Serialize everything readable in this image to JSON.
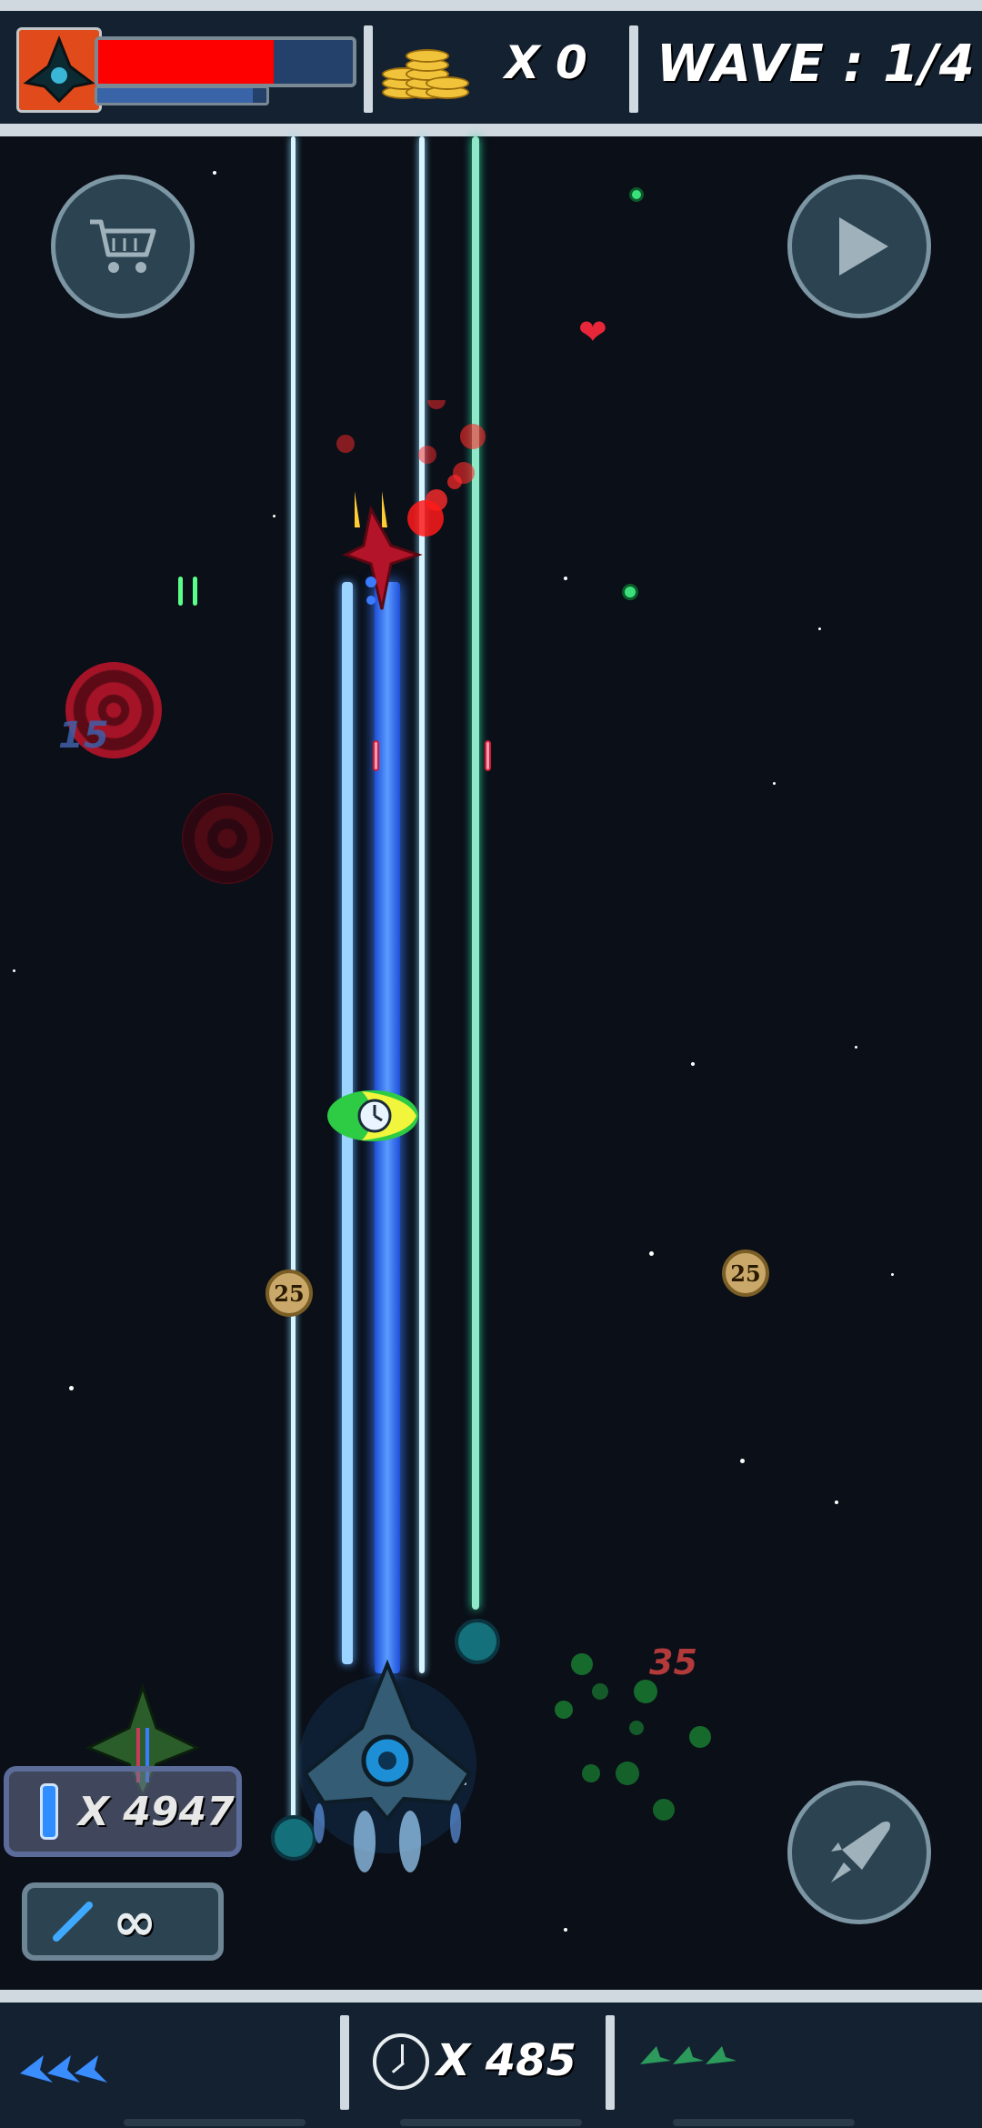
{
  "hud": {
    "player_health_pct": 0.69,
    "player_shield_pct": 0.92,
    "coins_label": "X 0",
    "wave_label": "WAVE : 1/4"
  },
  "powerup": {
    "label": "X 4947"
  },
  "weapon": {
    "label": "∞"
  },
  "bottom": {
    "timer_label": "X 485"
  },
  "drops": {
    "coin_left": "25",
    "coin_right": "25"
  },
  "damage_numbers": {
    "left": "15",
    "right": "35"
  },
  "colors": {
    "hud_bg": "#142131",
    "hud_border": "#cfd9df",
    "health": "#ff0000",
    "beam_main": "#2f6fff",
    "beam_side": "#8fe8c8"
  }
}
